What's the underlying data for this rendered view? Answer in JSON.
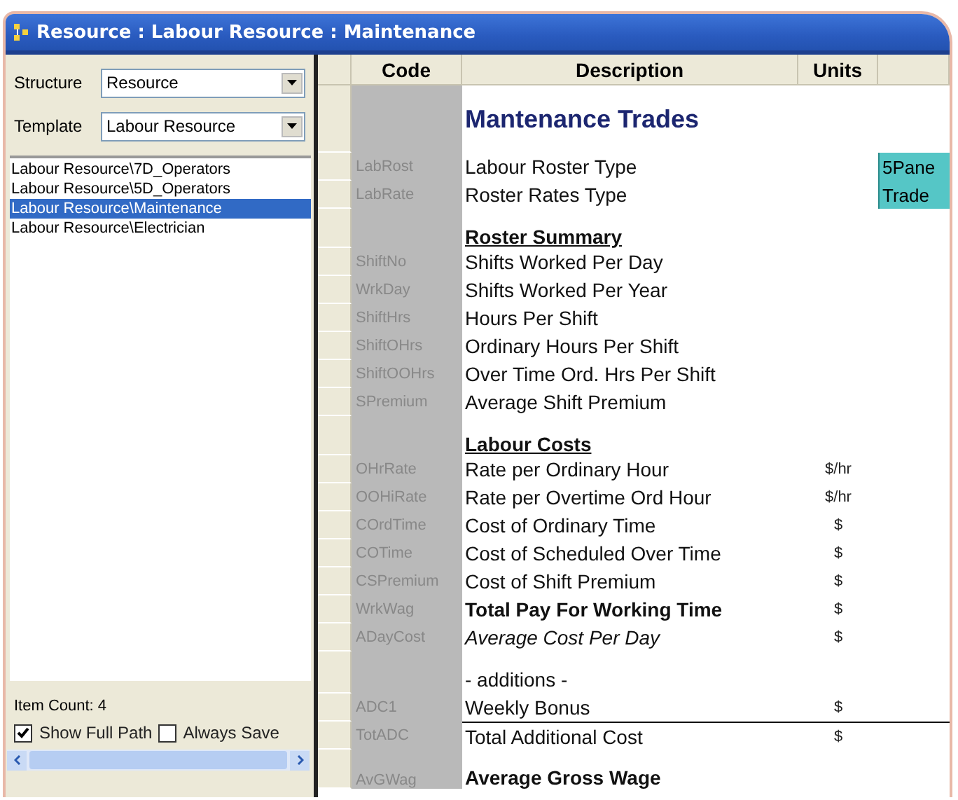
{
  "window": {
    "title": "Resource : Labour Resource : Maintenance"
  },
  "sidebar": {
    "structure": {
      "label": "Structure",
      "value": "Resource"
    },
    "template": {
      "label": "Template",
      "value": "Labour Resource"
    },
    "items": [
      {
        "label": "Labour Resource\\7D_Operators",
        "selected": false
      },
      {
        "label": "Labour Resource\\5D_Operators",
        "selected": false
      },
      {
        "label": "Labour Resource\\Maintenance",
        "selected": true
      },
      {
        "label": "Labour Resource\\Electrician",
        "selected": false
      }
    ],
    "item_count": "Item Count: 4",
    "checkboxes": [
      {
        "label": "Show Full Path",
        "checked": true
      },
      {
        "label": "Always Save",
        "checked": false
      }
    ]
  },
  "table": {
    "columns": [
      "Code",
      "Description",
      "Units"
    ],
    "rows": [
      {
        "kind": "title",
        "description": "Mantenance Trades"
      },
      {
        "kind": "item",
        "code": "LabRost",
        "description": "Labour Roster Type",
        "value": "5Pane"
      },
      {
        "kind": "item",
        "code": "LabRate",
        "description": "Roster Rates Type",
        "value": "Trade"
      },
      {
        "kind": "section",
        "description": "Roster Summary"
      },
      {
        "kind": "item",
        "code": "ShiftNo",
        "description": "Shifts Worked Per Day"
      },
      {
        "kind": "item",
        "code": "WrkDay",
        "description": "Shifts Worked Per Year"
      },
      {
        "kind": "item",
        "code": "ShiftHrs",
        "description": "Hours Per Shift"
      },
      {
        "kind": "item",
        "code": "ShiftOHrs",
        "description": "Ordinary Hours Per Shift"
      },
      {
        "kind": "item",
        "code": "ShiftOOHrs",
        "description": "Over Time Ord. Hrs Per Shift"
      },
      {
        "kind": "item",
        "code": "SPremium",
        "description": "Average Shift Premium"
      },
      {
        "kind": "section",
        "description": "Labour Costs"
      },
      {
        "kind": "item",
        "code": "OHrRate",
        "description": "Rate per Ordinary Hour",
        "units": "$/hr"
      },
      {
        "kind": "item",
        "code": "OOHiRate",
        "description": "Rate per Overtime Ord Hour",
        "units": "$/hr"
      },
      {
        "kind": "item",
        "code": "COrdTime",
        "description": "Cost of Ordinary Time",
        "units": "$"
      },
      {
        "kind": "item",
        "code": "COTime",
        "description": "Cost of Scheduled Over Time",
        "units": "$"
      },
      {
        "kind": "item",
        "code": "CSPremium",
        "description": "Cost of Shift Premium",
        "units": "$"
      },
      {
        "kind": "item",
        "code": "WrkWag",
        "description": "Total Pay For Working Time",
        "units": "$",
        "bold": true
      },
      {
        "kind": "item",
        "code": "ADayCost",
        "description": "Average Cost Per Day",
        "units": "$",
        "italic": true
      },
      {
        "kind": "note",
        "description": "- additions -"
      },
      {
        "kind": "item",
        "code": "ADC1",
        "description": "Weekly Bonus",
        "units": "$"
      },
      {
        "kind": "total",
        "code": "TotADC",
        "description": "Total Additional Cost",
        "units": "$"
      },
      {
        "kind": "summary",
        "code": "AvGWag",
        "description": "Average Gross Wage"
      }
    ]
  }
}
